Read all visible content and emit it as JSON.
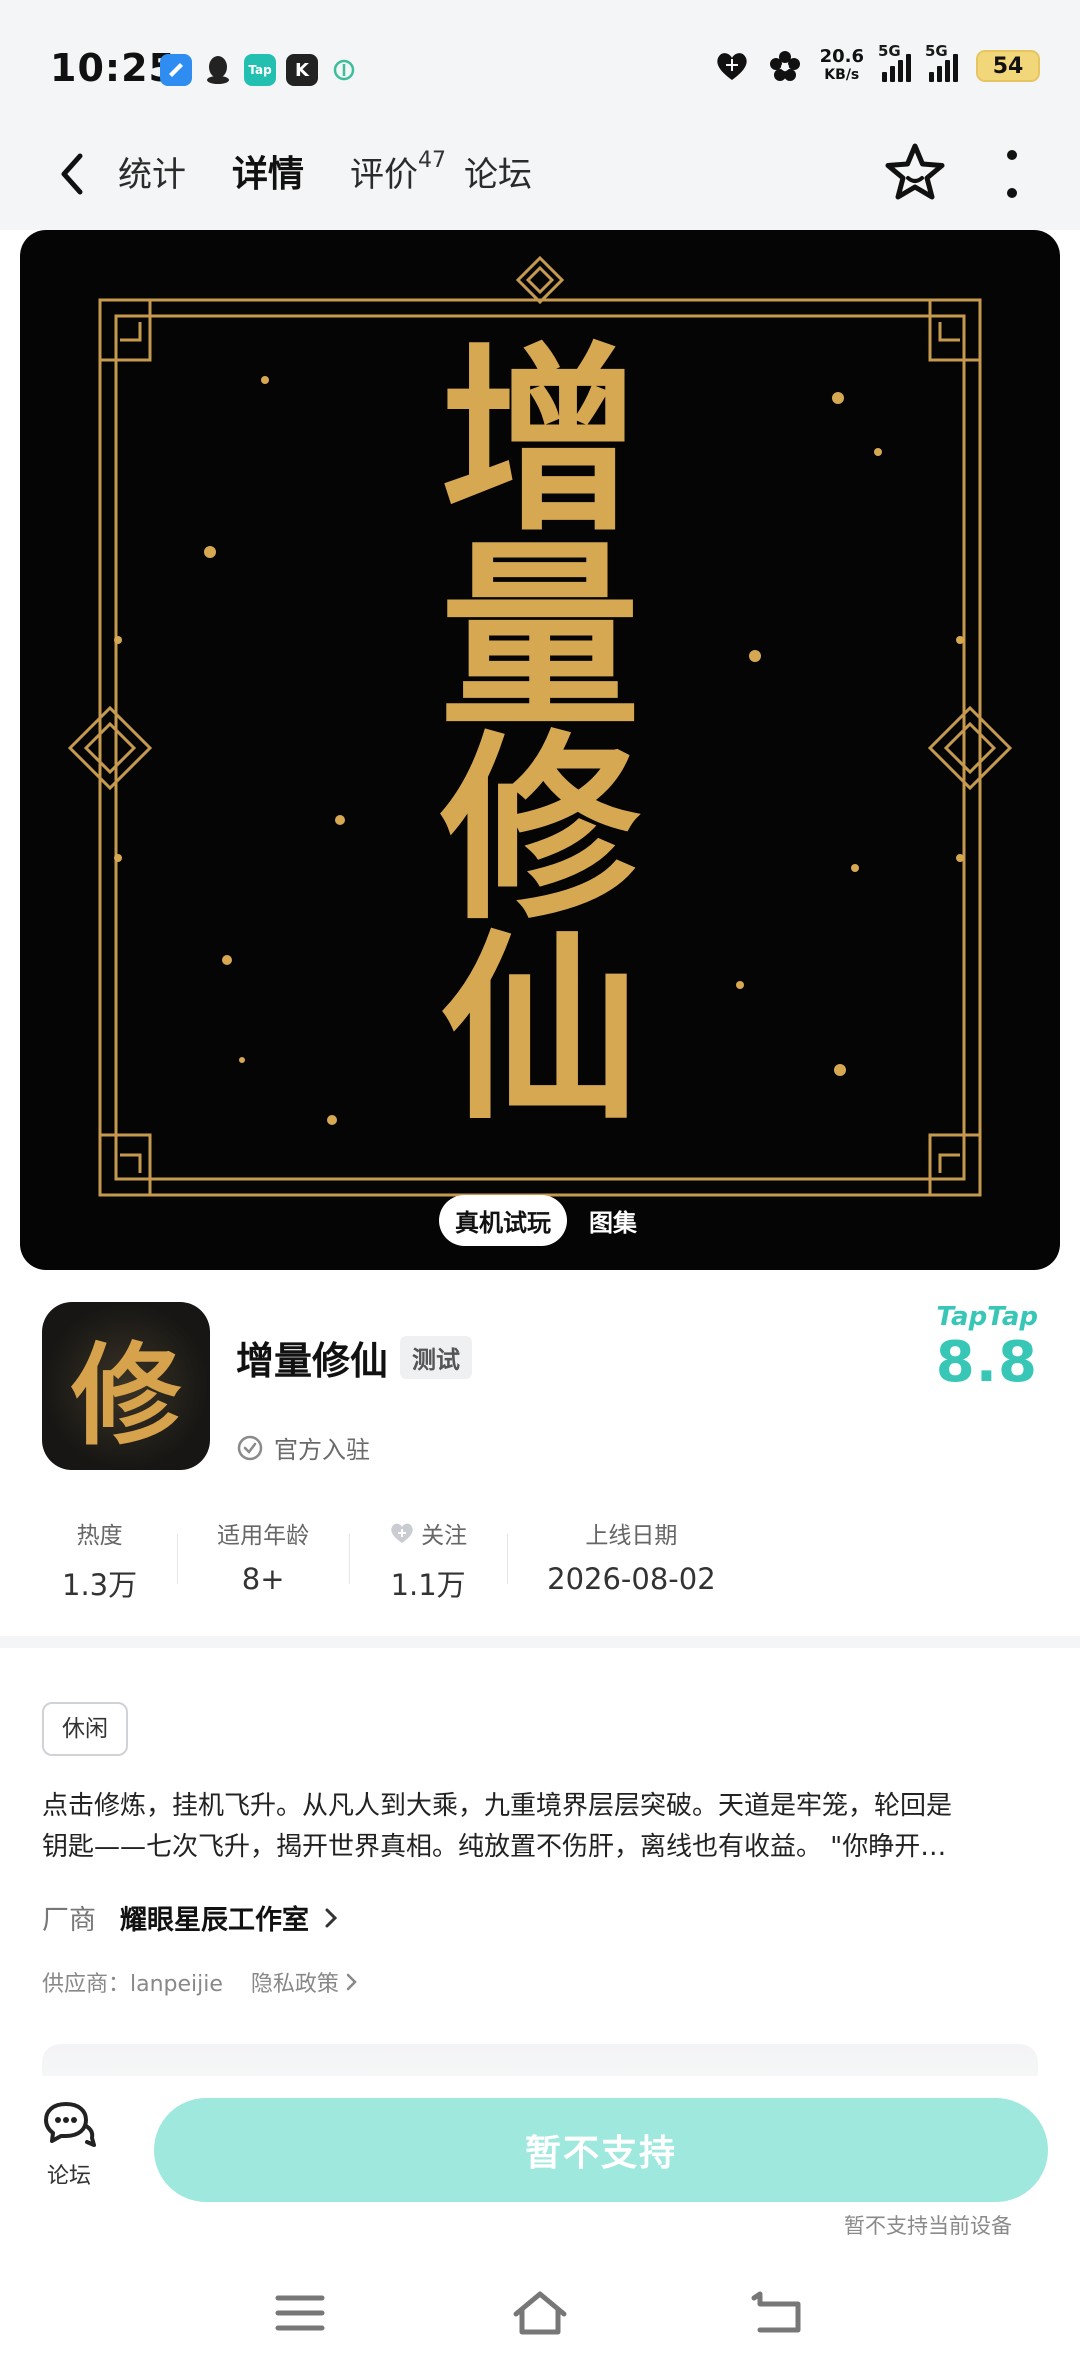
{
  "status_bar": {
    "time": "10:25",
    "apps": [
      {
        "icon": "app-blue-icon",
        "color": "#2f8cf0",
        "text": ""
      },
      {
        "icon": "qq-icon",
        "color": "#222222",
        "text": ""
      },
      {
        "icon": "taptap-icon",
        "color": "#23c0b2",
        "text": "Tap"
      },
      {
        "icon": "k-app-icon",
        "color": "#222222",
        "text": "K"
      },
      {
        "icon": "app-green-icon",
        "color": "#3bbf9a",
        "text": ""
      }
    ],
    "network_speed_value": "20.6",
    "network_speed_unit": "KB/s",
    "signal_1": "5G",
    "signal_2": "5G",
    "battery": "54"
  },
  "nav": {
    "tabs": [
      {
        "label": "统计",
        "active": false
      },
      {
        "label": "详情",
        "active": true
      },
      {
        "label": "评价",
        "active": false,
        "count": "47"
      },
      {
        "label": "论坛",
        "active": false
      }
    ]
  },
  "banner": {
    "art_title": [
      "增",
      "量",
      "修",
      "仙"
    ],
    "buttons": [
      "真机试玩",
      "图集"
    ]
  },
  "app": {
    "icon_glyph": "修",
    "name": "增量修仙",
    "badge": "测试",
    "official": "官方入驻",
    "rating_brand": "TapTap",
    "rating": "8.8",
    "accent_color": "#38c7b6"
  },
  "stats": [
    {
      "label": "热度",
      "value": "1.3万"
    },
    {
      "label": "适用年龄",
      "value": "8+"
    },
    {
      "label": "关注",
      "value": "1.1万",
      "icon": "heart-plus-icon"
    },
    {
      "label": "上线日期",
      "value": "2026-08-02"
    }
  ],
  "details": {
    "genre": "休闲",
    "description_line1": "点击修炼，挂机飞升。从凡人到大乘，九重境界层层突破。天道是牢笼，轮回是",
    "description_line2": "钥匙——七次飞升，揭开世界真相。纯放置不伤肝，离线也有收益。 \"你睁开…",
    "developer_label": "厂商",
    "developer_name": "耀眼星辰工作室",
    "supplier": "供应商：lanpeijie",
    "privacy": "隐私政策"
  },
  "bottom_bar": {
    "forum_label": "论坛",
    "cta_label": "暂不支持",
    "cta_note": "暂不支持当前设备"
  }
}
